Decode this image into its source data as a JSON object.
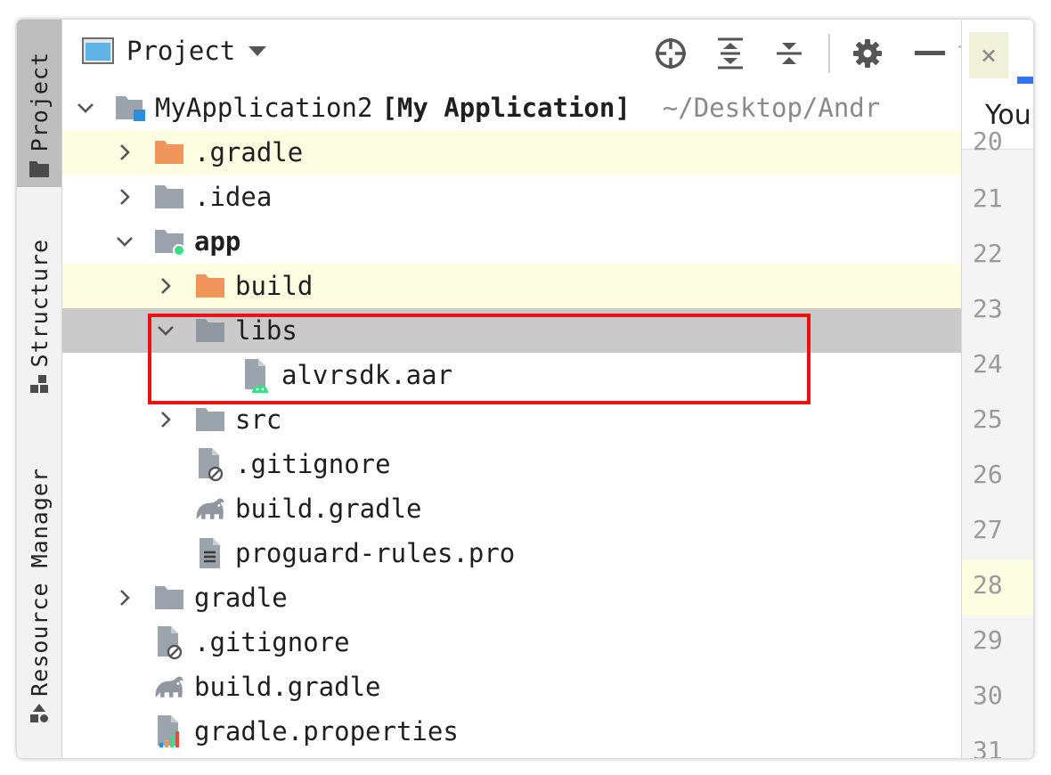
{
  "sidebar_tabs": [
    {
      "label": "Project",
      "icon": "folder-icon",
      "active": true
    },
    {
      "label": "Structure",
      "icon": "structure-icon",
      "active": false
    },
    {
      "label": "Resource Manager",
      "icon": "resource-manager-icon",
      "active": false
    }
  ],
  "toolbar": {
    "title": "Project",
    "dropdown_icon": "caret-down-icon",
    "buttons": [
      "locate-icon",
      "expand-all-icon",
      "collapse-all-icon",
      "gear-icon",
      "hide-icon"
    ],
    "truncated_char": "l"
  },
  "tree": [
    {
      "label": "MyApplication2",
      "extra": "[My Application]",
      "path": "~/Desktop/Andr",
      "icon": "module-folder-icon",
      "expanded": true
    },
    {
      "label": ".gradle",
      "icon": "orange-folder-icon",
      "expanded": false
    },
    {
      "label": ".idea",
      "icon": "folder-icon",
      "expanded": false
    },
    {
      "label": "app",
      "icon": "android-module-icon",
      "expanded": true
    },
    {
      "label": "build",
      "icon": "orange-folder-icon",
      "expanded": false
    },
    {
      "label": "libs",
      "icon": "folder-icon",
      "expanded": true,
      "selected": true
    },
    {
      "label": "alvrsdk.aar",
      "icon": "aar-file-icon"
    },
    {
      "label": "src",
      "icon": "folder-icon",
      "expanded": false
    },
    {
      "label": ".gitignore",
      "icon": "ignore-file-icon"
    },
    {
      "label": "build.gradle",
      "icon": "gradle-icon"
    },
    {
      "label": "proguard-rules.pro",
      "icon": "text-file-icon"
    },
    {
      "label": "gradle",
      "icon": "folder-icon",
      "expanded": false
    },
    {
      "label": ".gitignore",
      "icon": "ignore-file-icon"
    },
    {
      "label": "build.gradle",
      "icon": "gradle-icon"
    },
    {
      "label": "gradle.properties",
      "icon": "properties-file-icon"
    }
  ],
  "editor": {
    "tab_text": "You",
    "close_label": "×",
    "line_numbers": [
      "20",
      "21",
      "22",
      "23",
      "24",
      "25",
      "26",
      "27",
      "28",
      "29",
      "30",
      "31"
    ],
    "current_line": "28"
  },
  "colors": {
    "highlight_row": "#fdfde2",
    "selected_row": "#cacaca",
    "annotation_box": "#ee1111",
    "folder_orange": "#f0955b",
    "folder_gray": "#9ba4ad"
  }
}
